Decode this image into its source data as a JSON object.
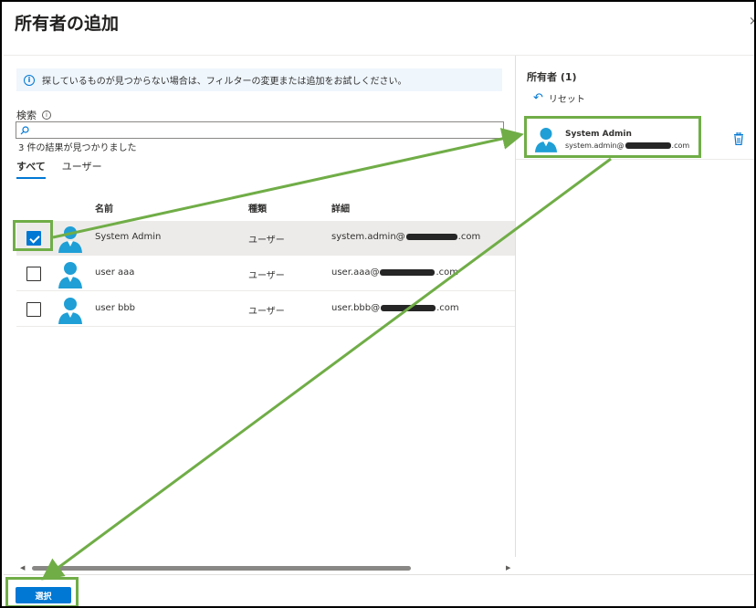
{
  "dialog": {
    "title": "所有者の追加",
    "close_glyph": "×"
  },
  "info_bar": {
    "text": "探しているものが見つからない場合は、フィルターの変更または追加をお試しください。"
  },
  "search": {
    "label": "検索",
    "value": "",
    "placeholder": ""
  },
  "results_count": "3 件の結果が見つかりました",
  "tabs": [
    {
      "label": "すべて",
      "active": true
    },
    {
      "label": "ユーザー",
      "active": false
    }
  ],
  "table": {
    "columns": {
      "name": "名前",
      "type": "種類",
      "details": "詳細"
    },
    "rows": [
      {
        "name": "System Admin",
        "type": "ユーザー",
        "email_prefix": "system.admin@",
        "email_suffix": ".com",
        "checked": true
      },
      {
        "name": "user aaa",
        "type": "ユーザー",
        "email_prefix": "user.aaa@",
        "email_suffix": ".com",
        "checked": false
      },
      {
        "name": "user bbb",
        "type": "ユーザー",
        "email_prefix": "user.bbb@",
        "email_suffix": ".com",
        "checked": false
      }
    ]
  },
  "owners_panel": {
    "title": "所有者 (1)",
    "reset_label": "リセット",
    "items": [
      {
        "name": "System Admin",
        "email_prefix": "system.admin@",
        "email_suffix": ".com"
      }
    ]
  },
  "footer": {
    "select_label": "選択"
  },
  "colors": {
    "accent": "#0078d4",
    "highlight": "#70ad47",
    "user_icon": "#1f9fd6"
  },
  "icons": {
    "info": "info-icon",
    "search": "search-icon",
    "user": "user-avatar-icon",
    "reset": "undo-icon",
    "trash": "trash-icon"
  }
}
